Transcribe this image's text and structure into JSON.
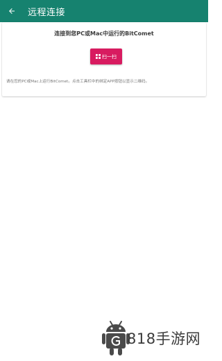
{
  "appbar": {
    "back_icon": "arrow-left-icon",
    "title": "远程连接",
    "color": "#16826f"
  },
  "connect": {
    "heading": "连接到您PC或Mac中运行的BitComet",
    "scan_button": {
      "icon": "qr-grid-icon",
      "label": "扫一扫",
      "color": "#d81b60"
    },
    "hint": "请在您的PC或Mac上运行BitComet。点击工具栏中的绑定APP按钮以显示二维码。"
  },
  "watermark": {
    "icon": "android-robot-icon",
    "text": "818手游网"
  }
}
